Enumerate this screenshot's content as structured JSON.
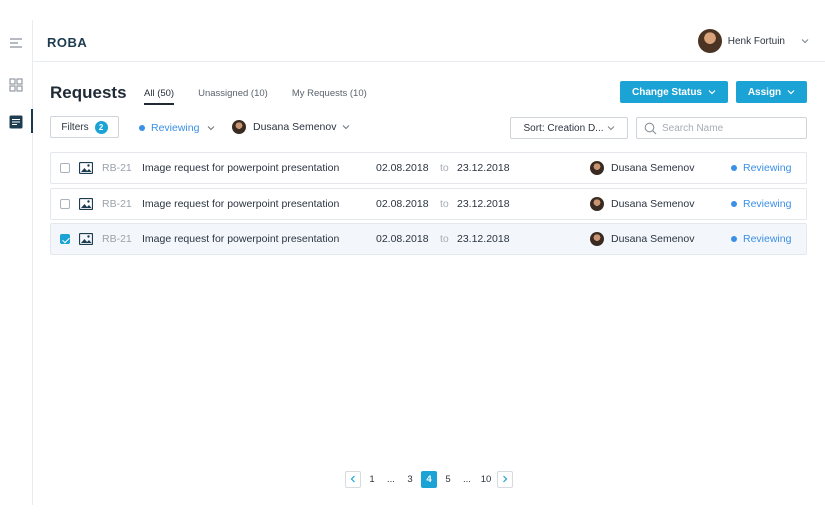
{
  "header": {
    "logo": "ROBA",
    "user_name": "Henk Fortuin"
  },
  "page": {
    "title": "Requests",
    "tabs": [
      {
        "label": "All (50)",
        "active": true
      },
      {
        "label": "Unassigned (10)",
        "active": false
      },
      {
        "label": "My Requests (10)",
        "active": false
      }
    ],
    "change_status_label": "Change Status",
    "assign_label": "Assign"
  },
  "filters": {
    "label": "Filters",
    "count": "2",
    "status": "Reviewing",
    "person": "Dusana Semenov",
    "sort_label": "Sort: Creation D...",
    "search_placeholder": "Search Name"
  },
  "rows": [
    {
      "checked": false,
      "code": "RB-21",
      "description": "Image request for powerpoint presentation",
      "start": "02.08.2018",
      "to": "to",
      "end": "23.12.2018",
      "assignee": "Dusana Semenov",
      "status": "Reviewing"
    },
    {
      "checked": false,
      "code": "RB-21",
      "description": "Image request for powerpoint presentation",
      "start": "02.08.2018",
      "to": "to",
      "end": "23.12.2018",
      "assignee": "Dusana Semenov",
      "status": "Reviewing"
    },
    {
      "checked": true,
      "code": "RB-21",
      "description": "Image request for powerpoint presentation",
      "start": "02.08.2018",
      "to": "to",
      "end": "23.12.2018",
      "assignee": "Dusana Semenov",
      "status": "Reviewing"
    }
  ],
  "pagination": {
    "pages": [
      "1",
      "...",
      "3",
      "4",
      "5",
      "...",
      "10"
    ],
    "current": "4"
  },
  "colors": {
    "accent": "#1aa3d4",
    "status_blue": "#3b8fe6",
    "brand_dark": "#1d3c50"
  },
  "icons": {
    "rail": [
      "menu-icon",
      "grid-icon",
      "list-icon"
    ],
    "row": "image-icon",
    "search": "search-icon"
  }
}
